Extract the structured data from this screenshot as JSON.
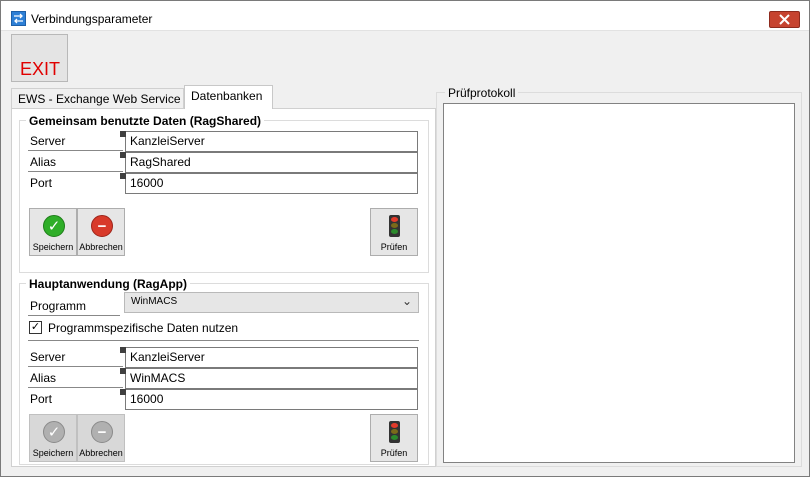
{
  "window": {
    "title": "Verbindungsparameter"
  },
  "toolbar": {
    "exit_label": "EXIT"
  },
  "tabs": [
    {
      "label": "EWS - Exchange Web Service",
      "active": false
    },
    {
      "label": "Datenbanken",
      "active": true
    }
  ],
  "shared": {
    "title": "Gemeinsam benutzte Daten (RagShared)",
    "rows": [
      {
        "label": "Server",
        "value": "KanzleiServer"
      },
      {
        "label": "Alias",
        "value": "RagShared"
      },
      {
        "label": "Port",
        "value": "16000"
      }
    ],
    "buttons": {
      "save": "Speichern",
      "cancel": "Abbrechen",
      "check": "Prüfen"
    }
  },
  "app": {
    "title": "Hauptanwendung (RagApp)",
    "program_label": "Programm",
    "program_value": "WinMACS",
    "checkbox_label": "Programmspezifische Daten nutzen",
    "checkbox_checked": true,
    "rows": [
      {
        "label": "Server",
        "value": "KanzleiServer"
      },
      {
        "label": "Alias",
        "value": "WinMACS"
      },
      {
        "label": "Port",
        "value": "16000"
      }
    ],
    "buttons": {
      "save": "Speichern",
      "cancel": "Abbrechen",
      "check": "Prüfen"
    }
  },
  "log": {
    "title": "Prüfprotokoll"
  },
  "icons": {
    "app": "window-icon",
    "close": "close-icon",
    "save": "checkmark-icon",
    "cancel": "no-entry-icon",
    "check": "traffic-light-icon",
    "dropdown": "chevron-down-icon"
  },
  "colors": {
    "exit": "#e00000",
    "save_green": "#2fae28",
    "cancel_red": "#d83a2a",
    "close_red": "#c6432f"
  }
}
